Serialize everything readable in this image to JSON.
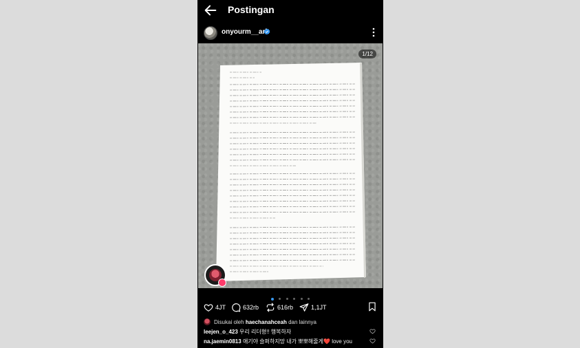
{
  "header": {
    "title": "Postingan"
  },
  "post": {
    "username": "onyourm__ark",
    "counter": "1/12"
  },
  "actions": {
    "likes": "4JT",
    "comments": "632rb",
    "reposts": "616rb",
    "shares": "1,1JT"
  },
  "liked_by": {
    "prefix": "Disukai oleh",
    "user": "haechanahceah",
    "suffix": "dan lainnya"
  },
  "comments": [
    {
      "user": "leejen_o_423",
      "text": "우리 리더형!! 행복하자"
    },
    {
      "user": "na.jaemin0813",
      "text": "애기야 슬퍼하지망 내가 뽀뽀해줄게❤️ love you"
    }
  ],
  "colors": {
    "accent": "#3797f0",
    "verified": "#3797f0",
    "background": "#000000"
  },
  "icons": [
    "back-arrow-icon",
    "verified-badge-icon",
    "more-options-icon",
    "heart-icon",
    "comment-icon",
    "repost-icon",
    "share-icon",
    "bookmark-icon"
  ]
}
